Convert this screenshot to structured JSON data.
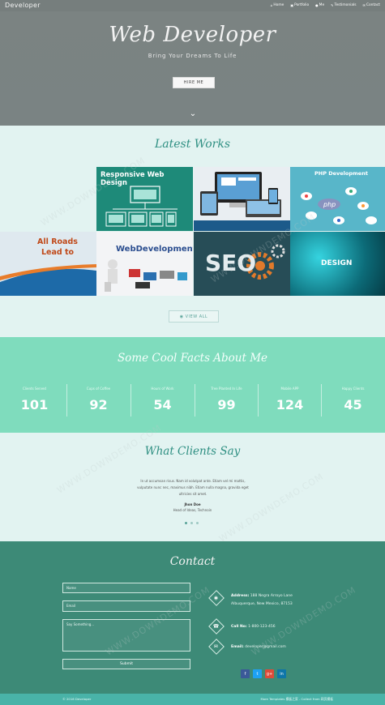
{
  "nav": {
    "brand": "Developer",
    "links": [
      {
        "icon": "home-icon",
        "glyph": "⌂",
        "label": "Home"
      },
      {
        "icon": "portfolio-icon",
        "glyph": "▣",
        "label": "Portfolio"
      },
      {
        "icon": "me-icon",
        "glyph": "●",
        "label": "Me"
      },
      {
        "icon": "testimonials-icon",
        "glyph": "✎",
        "label": "Testimonials"
      },
      {
        "icon": "contact-icon",
        "glyph": "✉",
        "label": "Contact"
      }
    ]
  },
  "hero": {
    "title": "Web Developer",
    "subtitle": "Bring Your Dreams To Life",
    "button": "HIRE ME",
    "scroll_glyph": "⌄"
  },
  "works": {
    "title": "Latest Works",
    "tiles": [
      {
        "label": "Responsive Web Design",
        "bg": "#1e8a79"
      },
      {
        "label": "",
        "bg": "#e9eef2"
      },
      {
        "label": "PHP Development",
        "bg": "#58b6c9"
      },
      {
        "label": "All Roads Lead to",
        "bg": "#dfe9ef"
      },
      {
        "label": "WebDevelopment",
        "bg": "#f3f4f6"
      },
      {
        "label": "SEO",
        "bg": "#274d57"
      },
      {
        "label": "DESIGN",
        "bg": "#0c6b78"
      }
    ],
    "view_all": "VIEW ALL"
  },
  "facts": {
    "title": "Some Cool Facts About Me",
    "items": [
      {
        "label": "Clients Served",
        "value": "101"
      },
      {
        "label": "Cups of Coffee",
        "value": "92"
      },
      {
        "label": "Hours of Work",
        "value": "54"
      },
      {
        "label": "Tree Planted In Life",
        "value": "99"
      },
      {
        "label": "Mobile APP",
        "value": "124"
      },
      {
        "label": "Happy Clients",
        "value": "45"
      }
    ]
  },
  "clients": {
    "title": "What Clients Say",
    "quote": "In ut accumsan risus. Nam id volutpat ante. Etiam vel mi mattis, vulputate nunc nec, maximus nibh. Etiam nulla magna, gravida eget ultricies sit amet.",
    "name": "Jhon Doe",
    "role": "Head of Ideas, Technoin"
  },
  "contact": {
    "title": "Contact",
    "name_placeholder": "Name",
    "email_placeholder": "Email",
    "message_placeholder": "Say Something...",
    "submit": "Submit",
    "address_label": "Address:",
    "address_line1": "188 Negra Arroyo Lane",
    "address_line2": "Albuquerque, New Mexico, 87153",
    "phone_label": "Call No:",
    "phone": "1-800-123-456",
    "email_label": "Email:",
    "email": "developer@gmail.com",
    "social": [
      {
        "icon": "facebook-icon",
        "glyph": "f",
        "color": "#3b5998"
      },
      {
        "icon": "twitter-icon",
        "glyph": "t",
        "color": "#1da1f2"
      },
      {
        "icon": "google-plus-icon",
        "glyph": "g+",
        "color": "#dd4b39"
      },
      {
        "icon": "linkedin-icon",
        "glyph": "in",
        "color": "#0e76a8"
      }
    ]
  },
  "footer": {
    "copyright": "© 2016 Developer",
    "credits": "More Templates 模板之家 - Collect from 网页模板"
  },
  "watermark": "WWW.DOWNDEMO.COM"
}
